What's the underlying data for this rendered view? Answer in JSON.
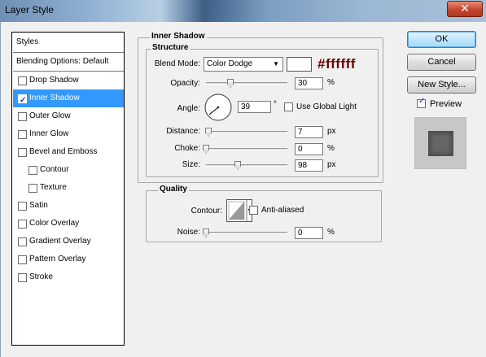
{
  "window": {
    "title": "Layer Style",
    "close_glyph": "✕"
  },
  "styles_list": {
    "header": "Styles",
    "blending": "Blending Options: Default",
    "items": [
      {
        "label": "Drop Shadow",
        "checked": false,
        "indent": false,
        "selected": false
      },
      {
        "label": "Inner Shadow",
        "checked": true,
        "indent": false,
        "selected": true
      },
      {
        "label": "Outer Glow",
        "checked": false,
        "indent": false,
        "selected": false
      },
      {
        "label": "Inner Glow",
        "checked": false,
        "indent": false,
        "selected": false
      },
      {
        "label": "Bevel and Emboss",
        "checked": false,
        "indent": false,
        "selected": false
      },
      {
        "label": "Contour",
        "checked": false,
        "indent": true,
        "selected": false
      },
      {
        "label": "Texture",
        "checked": false,
        "indent": true,
        "selected": false
      },
      {
        "label": "Satin",
        "checked": false,
        "indent": false,
        "selected": false
      },
      {
        "label": "Color Overlay",
        "checked": false,
        "indent": false,
        "selected": false
      },
      {
        "label": "Gradient Overlay",
        "checked": false,
        "indent": false,
        "selected": false
      },
      {
        "label": "Pattern Overlay",
        "checked": false,
        "indent": false,
        "selected": false
      },
      {
        "label": "Stroke",
        "checked": false,
        "indent": false,
        "selected": false
      }
    ]
  },
  "panel": {
    "title": "Inner Shadow",
    "structure": {
      "title": "Structure",
      "blend_mode_label": "Blend Mode:",
      "blend_mode_value": "Color Dodge",
      "color_annotation": "#ffffff",
      "swatch_color": "#ffffff",
      "opacity_label": "Opacity:",
      "opacity_value": "30",
      "opacity_unit": "%",
      "opacity_level": 0.3,
      "angle_label": "Angle:",
      "angle_value": "39",
      "angle_unit": "°",
      "global_light_label": "Use Global Light",
      "global_light_checked": false,
      "distance_label": "Distance:",
      "distance_value": "7",
      "distance_unit": "px",
      "distance_level": 0.03,
      "choke_label": "Choke:",
      "choke_value": "0",
      "choke_unit": "%",
      "choke_level": 0.0,
      "size_label": "Size:",
      "size_value": "98",
      "size_unit": "px",
      "size_level": 0.39
    },
    "quality": {
      "title": "Quality",
      "contour_label": "Contour:",
      "anti_aliased_label": "Anti-aliased",
      "anti_aliased_checked": false,
      "noise_label": "Noise:",
      "noise_value": "0",
      "noise_unit": "%",
      "noise_level": 0.0
    }
  },
  "buttons": {
    "ok": "OK",
    "cancel": "Cancel",
    "new_style": "New Style...",
    "preview_label": "Preview",
    "preview_checked": true
  },
  "colors": {
    "selection": "#3399ff",
    "annotation": "#6b0000"
  }
}
